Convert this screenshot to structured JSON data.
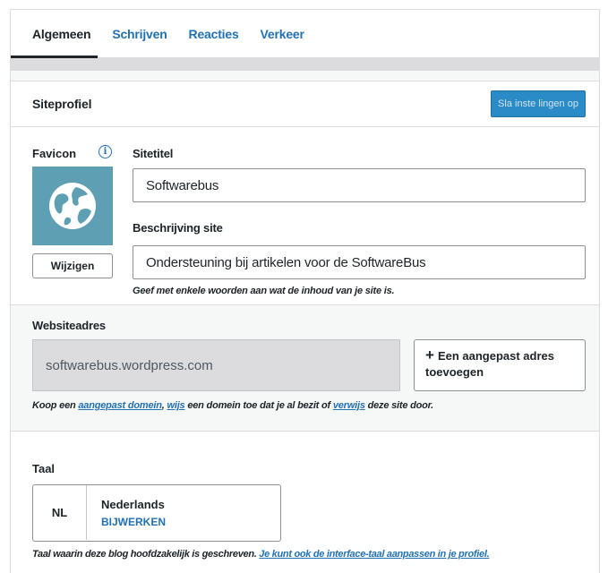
{
  "tabs": [
    {
      "label": "Algemeen",
      "active": true
    },
    {
      "label": "Schrijven",
      "active": false
    },
    {
      "label": "Reacties",
      "active": false
    },
    {
      "label": "Verkeer",
      "active": false
    }
  ],
  "card": {
    "title": "Siteprofiel",
    "save_label": "Sla inste lingen op"
  },
  "favicon": {
    "label": "Favicon",
    "info_icon": "i",
    "icon": "globe-icon",
    "change_label": "Wijzigen"
  },
  "site_title": {
    "label": "Sitetitel",
    "value": "Softwarebus"
  },
  "description": {
    "label": "Beschrijving site",
    "value": "Ondersteuning bij artikelen voor de SoftwareBus",
    "hint": "Geef met enkele woorden aan wat de inhoud van je site is."
  },
  "address": {
    "label": "Websiteadres",
    "value": "softwarebus.wordpress.com",
    "button_plus": "+",
    "button_label": "Een aangepast adres toevoegen",
    "hint_part1": "Koop een ",
    "hint_link1": "aangepast domein",
    "hint_part2": ", ",
    "hint_link2": "wijs",
    "hint_part3": " een domein toe dat je al bezit of ",
    "hint_link3": "verwijs",
    "hint_part4": " deze site door."
  },
  "language": {
    "label": "Taal",
    "code": "NL",
    "name": "Nederlands",
    "update_label": "BIJWERKEN",
    "hint_text": "Taal waarin deze blog hoofdzakelijk is geschreven. ",
    "hint_link": "Je kunt ook de interface-taal aanpassen in je profiel."
  },
  "colors": {
    "accent": "#2271b1",
    "save_button": "#2b8bc6",
    "favicon_bg": "#5e9fb3",
    "address_bg": "#dcdcde"
  }
}
